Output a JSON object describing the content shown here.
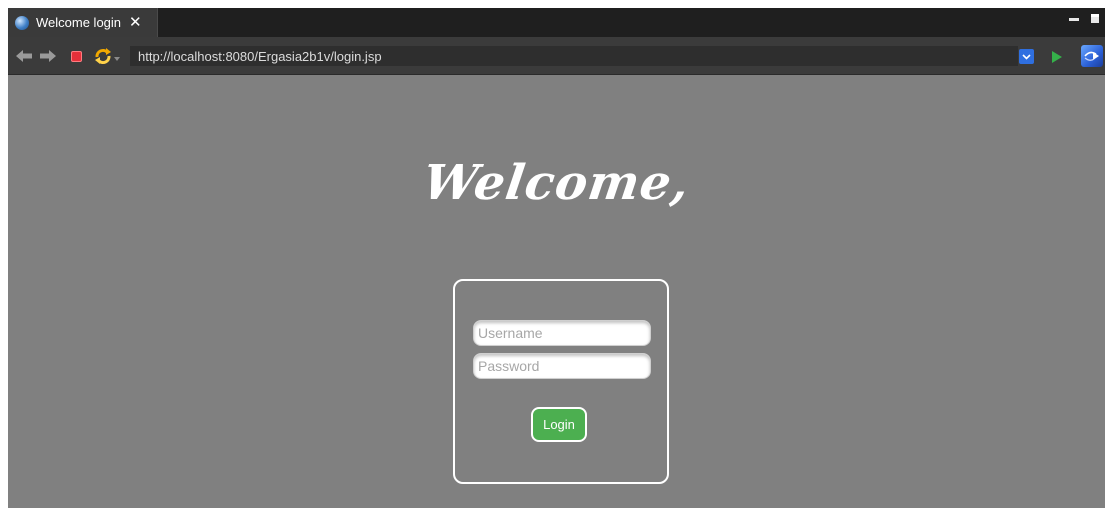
{
  "tab": {
    "title": "Welcome login",
    "close_glyph": "✕",
    "icon": "globe-icon"
  },
  "window_controls": {
    "minimize_icon": "minimize-icon",
    "maximize_icon": "maximize-icon"
  },
  "toolbar": {
    "back_icon": "back-arrow-icon",
    "forward_icon": "forward-arrow-icon",
    "stop_icon": "stop-icon",
    "refresh_icon": "refresh-icon",
    "url": "http://localhost:8080/Ergasia2b1v/login.jsp",
    "dropdown_icon": "chevron-down-icon",
    "go_icon": "go-icon",
    "extension_icon": "extension-icon"
  },
  "colors": {
    "page_background": "#808080",
    "button_green": "#4caf50",
    "go_green": "#35b04a",
    "stop_red": "#e5303a",
    "accent_blue": "#2f6fe0"
  },
  "page": {
    "heading": "Welcome,",
    "username_placeholder": "Username",
    "password_placeholder": "Password",
    "login_label": "Login"
  }
}
